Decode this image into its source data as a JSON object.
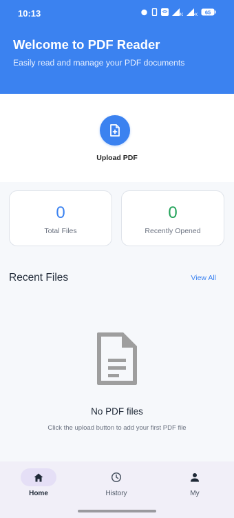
{
  "status_bar": {
    "time": "10:13",
    "icons": [
      "alarm-icon",
      "vibrate-icon",
      "wifi-icon",
      "signal-icon",
      "signal-icon",
      "battery-icon"
    ],
    "battery_level": "65"
  },
  "header": {
    "title": "Welcome to PDF Reader",
    "subtitle": "Easily read and manage your PDF documents",
    "background_color": "#3b82f0"
  },
  "upload": {
    "icon": "file-plus-icon",
    "label": "Upload PDF"
  },
  "stats": [
    {
      "value": "0",
      "label": "Total Files",
      "color": "#3b82f0"
    },
    {
      "value": "0",
      "label": "Recently Opened",
      "color": "#23a35a"
    }
  ],
  "recent": {
    "title": "Recent Files",
    "view_all": "View All"
  },
  "empty_state": {
    "icon": "document-icon",
    "title": "No PDF files",
    "description": "Click the upload button to add your first PDF file"
  },
  "bottom_nav": {
    "items": [
      {
        "label": "Home",
        "icon": "home-icon",
        "active": true
      },
      {
        "label": "History",
        "icon": "history-icon",
        "active": false
      },
      {
        "label": "My",
        "icon": "person-icon",
        "active": false
      }
    ]
  }
}
